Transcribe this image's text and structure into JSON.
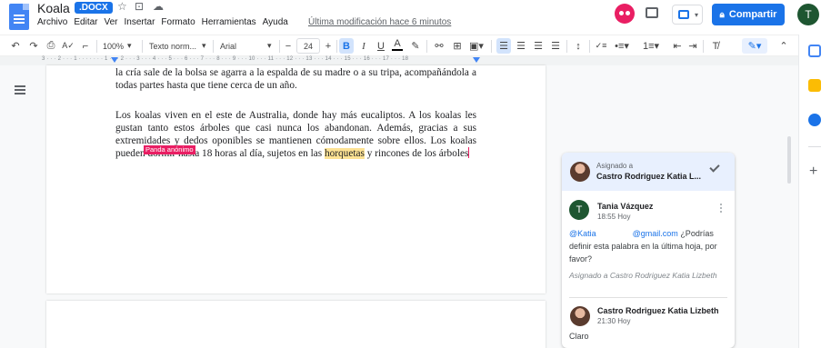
{
  "header": {
    "title": "Koala",
    "badge": ".DOCX",
    "menu": [
      "Archivo",
      "Editar",
      "Ver",
      "Insertar",
      "Formato",
      "Herramientas",
      "Ayuda"
    ],
    "last_edit": "Última modificación hace 6 minutos",
    "share_label": "Compartir",
    "user_initial": "T"
  },
  "toolbar": {
    "zoom": "100%",
    "style": "Texto norm...",
    "font": "Arial",
    "font_size": "24",
    "icons": [
      "undo-icon",
      "redo-icon",
      "print-icon",
      "spellcheck-icon",
      "paint-format-icon",
      "bold-icon",
      "italic-icon",
      "underline-icon",
      "text-color-icon",
      "highlight-icon",
      "link-icon",
      "comment-icon",
      "image-icon",
      "align-left-icon",
      "align-center-icon",
      "align-right-icon",
      "justify-icon",
      "line-spacing-icon",
      "checklist-icon",
      "bullet-list-icon",
      "numbered-list-icon",
      "decrease-indent-icon",
      "increase-indent-icon",
      "clear-format-icon",
      "edit-mode-icon",
      "collapse-icon"
    ]
  },
  "ruler": {
    "text": "3 · · · 2 · · · 1 · · · · · · · 1 · · · 2 · · · 3 · · · 4 · · · 5 · · · 6 · · · 7 · · · 8 · · · 9 · · · 10 · · · 11 · · · 12 · · · 13 · · · 14 · · · 15 · · · 16 · · · 17 · · · 18"
  },
  "document": {
    "para1": "la cría sale de la bolsa se agarra a la espalda de su madre o a su tripa, acompañándola a todas partes hasta que tiene cerca de un año.",
    "para2_a": "Los koalas viven en el este de Australia, donde hay más eucaliptos. A los koalas les gustan tanto estos árboles que casi nunca los abandonan. Además, gracias a sus extremidades y dedos oponibles se mantienen cómodamente sobre ellos. Los koalas pueden dormir hasta 18 horas al día, sujetos en las ",
    "para2_highlight": "horquetas",
    "para2_b": " y rincones de los árboles",
    "cursor_label": "Panda anónimo"
  },
  "comment": {
    "assigned_to_label": "Asignado a",
    "assignee": "Castro Rodriguez Katia L...",
    "author1": "Tania Vázquez",
    "time1": "18:55 Hoy",
    "mention_name": "@Katia",
    "mention_email": "@gmail.com",
    "body": " ¿Podrías definir esta palabra en la última hoja, por favor?",
    "assigned_note": "Asignado a Castro Rodriguez Katia Lizbeth",
    "author2": "Castro Rodriguez Katia Lizbeth",
    "time2": "21:30 Hoy",
    "reply": "Claro",
    "author1_initial": "T"
  },
  "colors": {
    "accent": "#1a73e8",
    "highlight": "#fde293",
    "collaborator": "#e91e63"
  }
}
